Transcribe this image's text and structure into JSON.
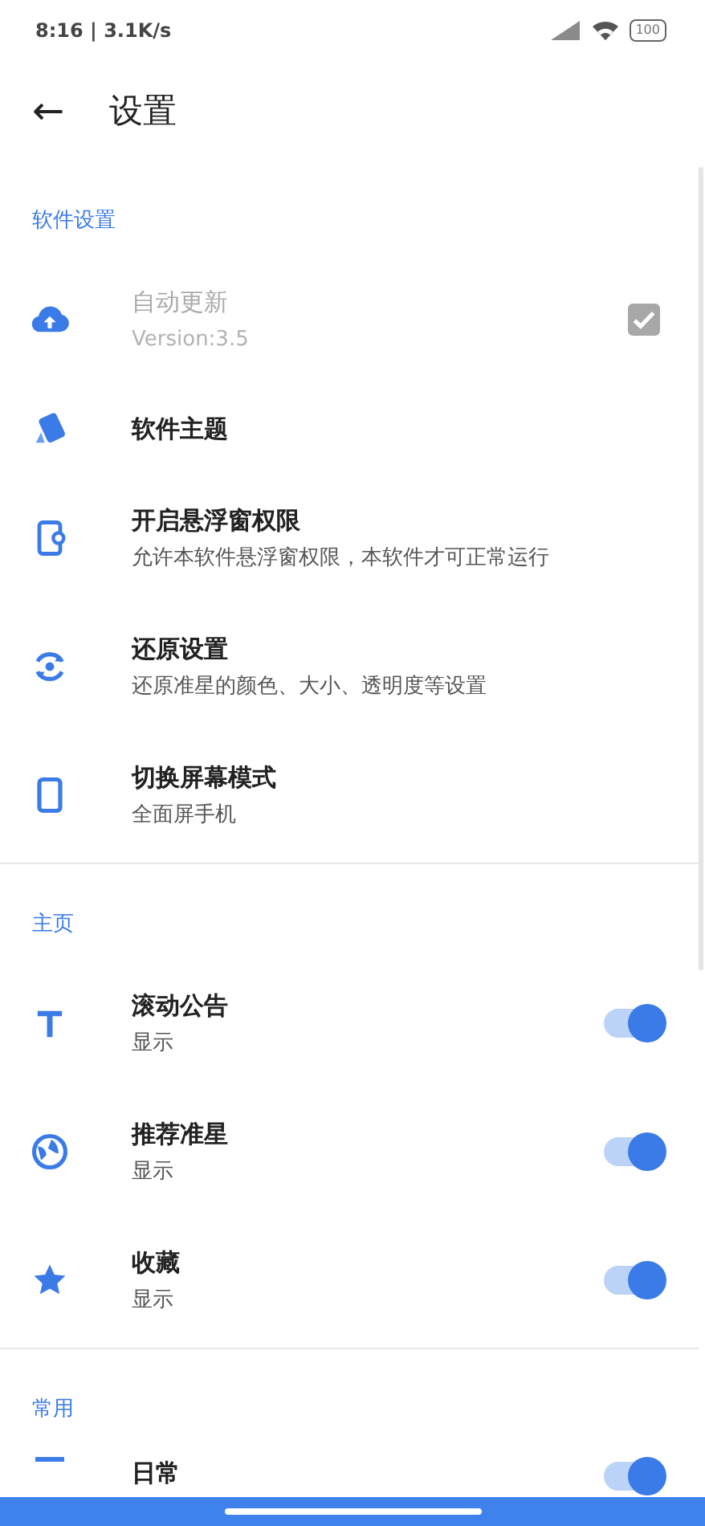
{
  "status_bar": {
    "time": "8:16 | 3.1K/s",
    "battery": "100"
  },
  "header": {
    "back": "←",
    "title": "设置"
  },
  "sections": [
    {
      "title": "软件设置",
      "rows": [
        {
          "kind": "checkbox",
          "title": "自动更新",
          "subtitle": "Version:3.5",
          "checked": true,
          "disabled": true
        },
        {
          "kind": "plain",
          "title": "软件主题"
        },
        {
          "kind": "plain",
          "title": "开启悬浮窗权限",
          "subtitle": "允许本软件悬浮窗权限，本软件才可正常运行"
        },
        {
          "kind": "plain",
          "title": "还原设置",
          "subtitle": "还原准星的颜色、大小、透明度等设置"
        },
        {
          "kind": "plain",
          "title": "切换屏幕模式",
          "subtitle": "全面屏手机"
        }
      ]
    },
    {
      "title": "主页",
      "rows": [
        {
          "kind": "toggle",
          "title": "滚动公告",
          "subtitle": "显示",
          "on": true
        },
        {
          "kind": "toggle",
          "title": "推荐准星",
          "subtitle": "显示",
          "on": true
        },
        {
          "kind": "toggle",
          "title": "收藏",
          "subtitle": "显示",
          "on": true
        }
      ]
    },
    {
      "title": "常用",
      "rows": [
        {
          "kind": "toggle",
          "title": "日常",
          "on": true
        }
      ]
    }
  ]
}
